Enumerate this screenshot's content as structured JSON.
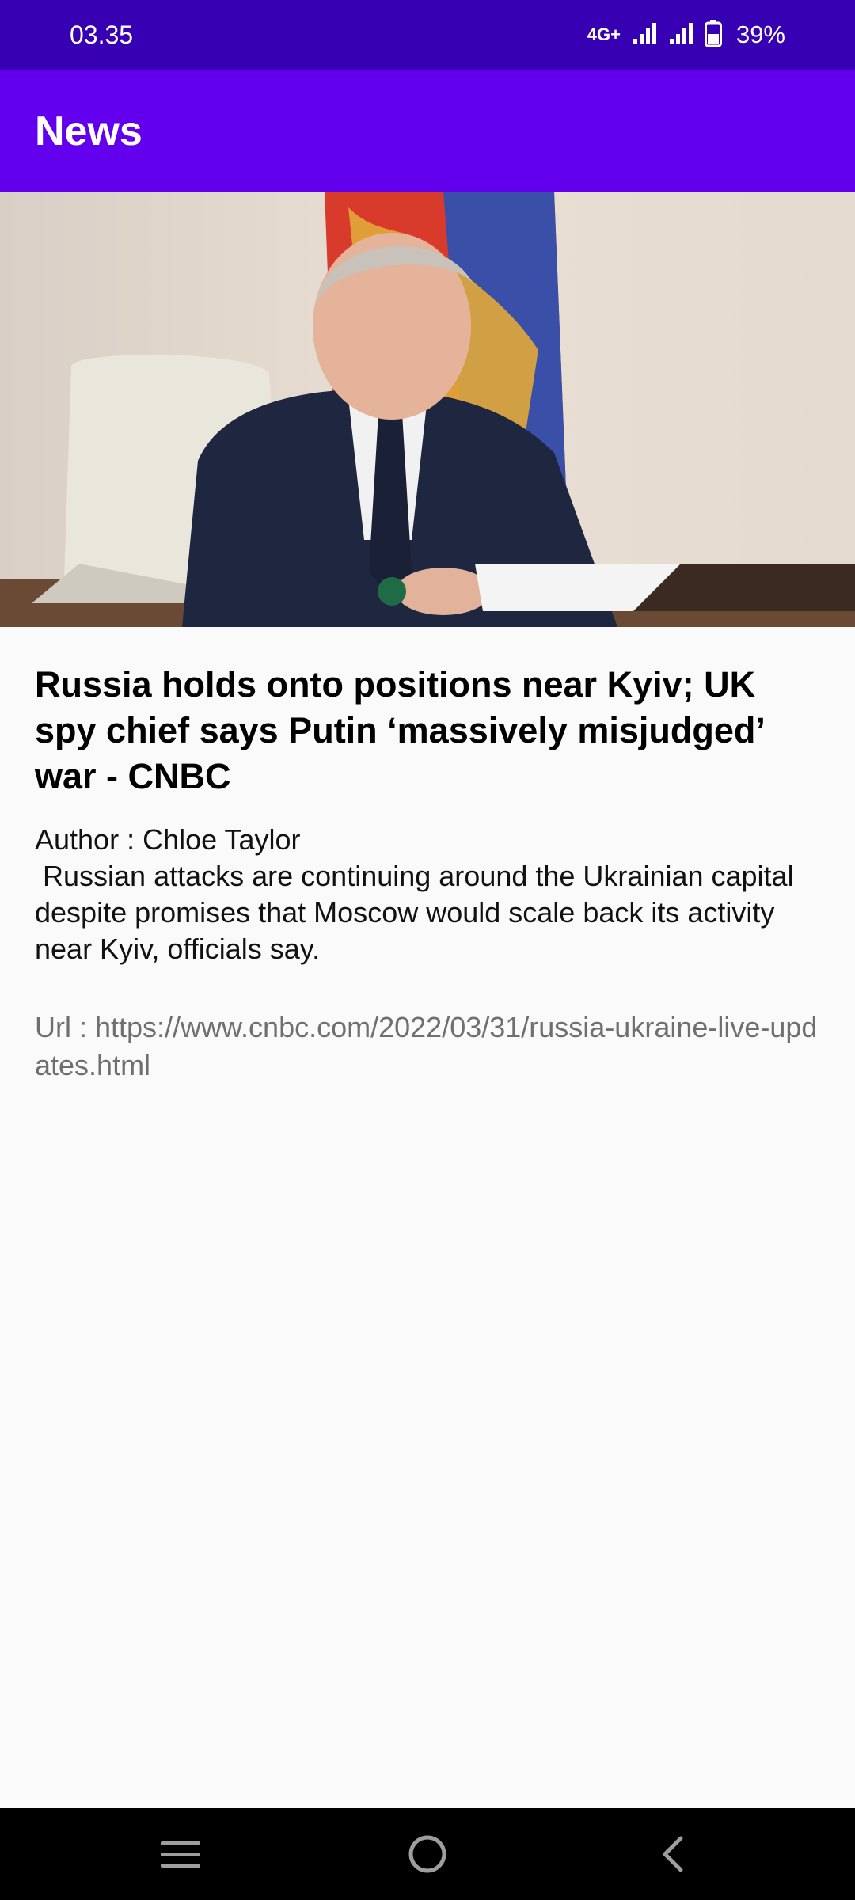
{
  "status_bar": {
    "time": "03.35",
    "network": "4G+",
    "battery": "39%",
    "icons": [
      "signal-icon",
      "signal-icon",
      "battery-icon"
    ]
  },
  "app_bar": {
    "title": "News"
  },
  "article": {
    "image_alt": "news-photo",
    "headline": "Russia holds onto positions near Kyiv; UK spy chief says Putin ‘massively misjudged’ war - CNBC",
    "author": "Author : Chloe Taylor",
    "description": " Russian attacks are continuing around the Ukrainian capital despite promises that Moscow would scale back its activity near Kyiv, officials say.",
    "url": "Url : https://www.cnbc.com/2022/03/31/russia-ukraine-live-updates.html"
  },
  "nav_bar": {
    "icons": [
      "menu-icon",
      "home-icon",
      "back-icon"
    ]
  },
  "colors": {
    "status_bar": "#3700b3",
    "app_bar": "#6200ee",
    "background": "#fafafa",
    "nav_bar": "#000000"
  }
}
